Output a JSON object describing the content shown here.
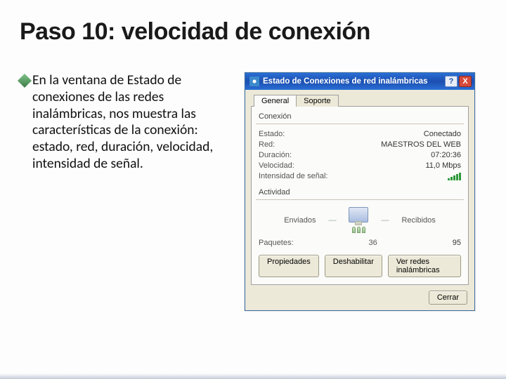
{
  "slide": {
    "title": "Paso 10: velocidad de conexión",
    "bullet": "En la ventana de Estado de conexiones de las redes inalámbricas, nos muestra las características de la conexión: estado, red, duración, velocidad, intensidad de señal."
  },
  "dialog": {
    "title": "Estado de Conexiones de red inalámbricas",
    "help_icon": "?",
    "close_icon": "X",
    "tabs": {
      "general": "General",
      "soporte": "Soporte"
    },
    "group_conexion": "Conexión",
    "fields": {
      "estado_k": "Estado:",
      "estado_v": "Conectado",
      "red_k": "Red:",
      "red_v": "MAESTROS DEL WEB",
      "duracion_k": "Duración:",
      "duracion_v": "07:20:36",
      "velocidad_k": "Velocidad:",
      "velocidad_v": "11,0 Mbps",
      "intensidad_k": "Intensidad de señal:"
    },
    "group_actividad": "Actividad",
    "activity": {
      "enviados": "Enviados",
      "recibidos": "Recibidos",
      "paquetes_k": "Paquetes:",
      "paquetes_env": "36",
      "paquetes_rec": "95"
    },
    "buttons": {
      "propiedades": "Propiedades",
      "deshabilitar": "Deshabilitar",
      "ver_redes": "Ver redes inalámbricas",
      "cerrar": "Cerrar"
    }
  }
}
